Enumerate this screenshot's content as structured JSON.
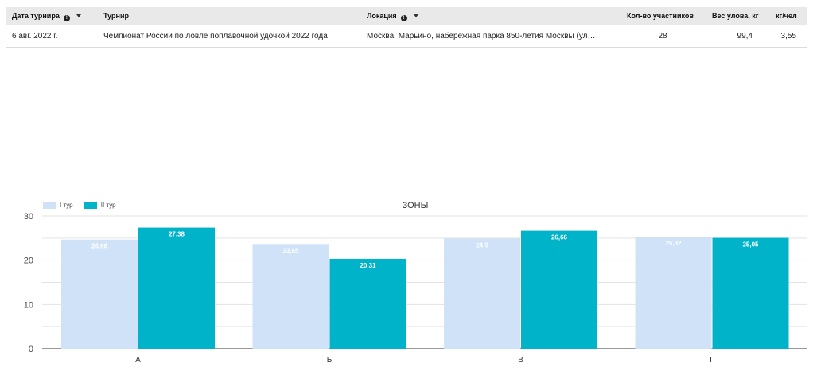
{
  "table": {
    "columns": [
      {
        "label": "Дата турнира",
        "has_info": true,
        "has_sort": true
      },
      {
        "label": "Турнир",
        "has_info": false,
        "has_sort": false
      },
      {
        "label": "Локация",
        "has_info": true,
        "has_sort": true
      },
      {
        "label": "Кол-во участников",
        "has_info": false,
        "has_sort": false
      },
      {
        "label": "Вес улова, кг",
        "has_info": false,
        "has_sort": false
      },
      {
        "label": "кг/чел",
        "has_info": false,
        "has_sort": false
      }
    ],
    "rows": [
      {
        "date": "6 авг. 2022 г.",
        "tournament": "Чемпионат России по ловле поплавочной удочкой 2022 года",
        "location": "Москва, Марьино, набережная парка 850-летия Москвы (ул…",
        "participants": "28",
        "catch": "99,4",
        "per_person": "3,55"
      }
    ]
  },
  "chart_data": {
    "type": "bar",
    "title": "ЗОНЫ",
    "categories": [
      "А",
      "Б",
      "В",
      "Г"
    ],
    "series": [
      {
        "name": "I тур",
        "values": [
          24.66,
          23.65,
          24.9,
          25.32
        ],
        "labels": [
          "24,66",
          "23,65",
          "24,9",
          "25,32"
        ],
        "color": "#cfe2f8"
      },
      {
        "name": "II тур",
        "values": [
          27.38,
          20.31,
          26.66,
          25.05
        ],
        "labels": [
          "27,38",
          "20,31",
          "26,66",
          "25,05"
        ],
        "color": "#00b3c9"
      }
    ],
    "ylim": [
      0,
      30
    ],
    "yticks": [
      0,
      10,
      20,
      30
    ],
    "grid": true,
    "legend": "top-left"
  }
}
